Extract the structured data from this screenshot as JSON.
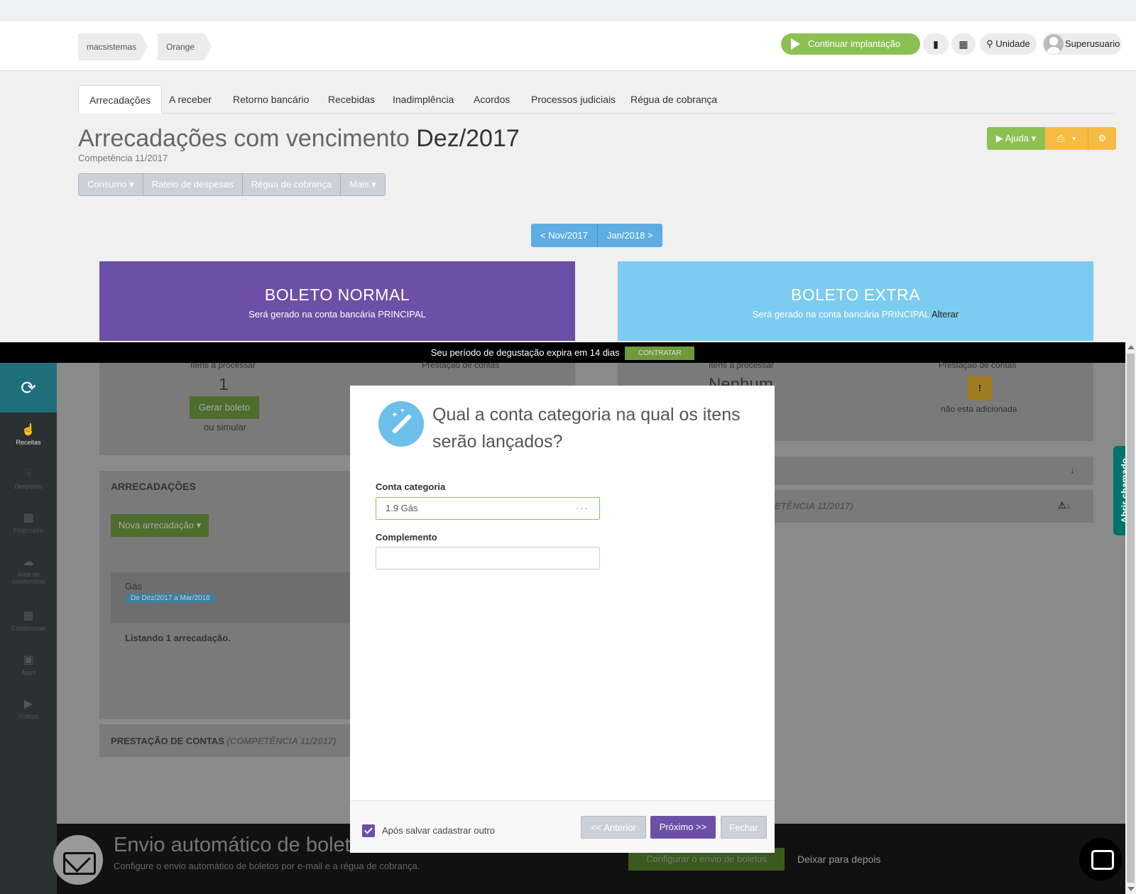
{
  "header": {
    "breadcrumb": [
      "macsistemas",
      "Orange"
    ],
    "continue_label": "Continuar implantação",
    "unit_label": "Unidade",
    "user_label": "Superusuario"
  },
  "tabs": [
    "Arrecadações",
    "A receber",
    "Retorno bancário",
    "Recebidas",
    "Inadimplência",
    "Acordos",
    "Processos judiciais",
    "Régua de cobrança"
  ],
  "page": {
    "title_prefix": "Arrecadações com vencimento",
    "title_month": "Dez/2017",
    "subtitle": "Competência 11/2017",
    "help_label": "Ajuda",
    "subnav": [
      "Consumo",
      "Rateio de despesas",
      "Régua de cobrança",
      "Mais"
    ],
    "prev_month": "< Nov/2017",
    "next_month": "Jan/2018 >"
  },
  "boletos": {
    "normal_title": "BOLETO NORMAL",
    "normal_sub": "Será gerado na conta bancária PRINCIPAL",
    "extra_title": "BOLETO EXTRA",
    "extra_sub": "Será gerado na conta bancária PRINCIPAL",
    "extra_link": "Alterar"
  },
  "trial": {
    "text": "Seu período de degustação expira em 14 dias",
    "button": "CONTRATAR"
  },
  "sidebar": [
    "Receitas",
    "Despesas",
    "Financeiro",
    "Área do condomínio",
    "Condomínio",
    "Apps",
    "Vídeos"
  ],
  "background": {
    "items_label": "Itens a processar",
    "items_count": "1",
    "accounts_label": "Prestação de contas",
    "items_label_2": "Itens a processar",
    "items_none": "Nenhum",
    "accounts_label_2": "Prestação de contas",
    "not_added": "não esta adicionada",
    "gerar_boleto": "Gerar boleto",
    "ou_simular": "ou simular",
    "arrecadacoes_heading": "ARRECADAÇÕES",
    "nova_arrecadacao": "Nova arrecadação",
    "gas_item": "Gás",
    "gas_period": "De Dez/2017 a Mar/2018",
    "listing": "Listando 1 arrecadação.",
    "prestacao_heading": "PRESTAÇÃO DE CONTAS",
    "prestacao_comp": "(COMPETÊNCIA 11/2017)",
    "right_comp": "ETÊNCIA 11/2017)"
  },
  "bottom_bar": {
    "title": "Envio automático de boletos",
    "subtitle": "Configure o envio automático de boletos por e-mail e a régua de cobrança.",
    "configure_button": "Configurar o envio de boletos",
    "later_link": "Deixar para depois"
  },
  "abrir_chamado": "Abrir chamado",
  "modal": {
    "title": "Qual a conta categoria na qual os itens serão lançados?",
    "category_label": "Conta categoria",
    "category_value": "1.9  Gás",
    "complement_label": "Complemento",
    "complement_value": "",
    "after_save_label": "Após salvar cadastrar outro",
    "after_save_checked": true,
    "prev_button": "<< Anterior",
    "next_button": "Próximo >>",
    "close_button": "Fechar"
  },
  "colors": {
    "purple": "#6c4fa6",
    "light_blue": "#7ccbf0",
    "green": "#8cc152",
    "yellow": "#f6bb42",
    "teal": "#00736b"
  }
}
